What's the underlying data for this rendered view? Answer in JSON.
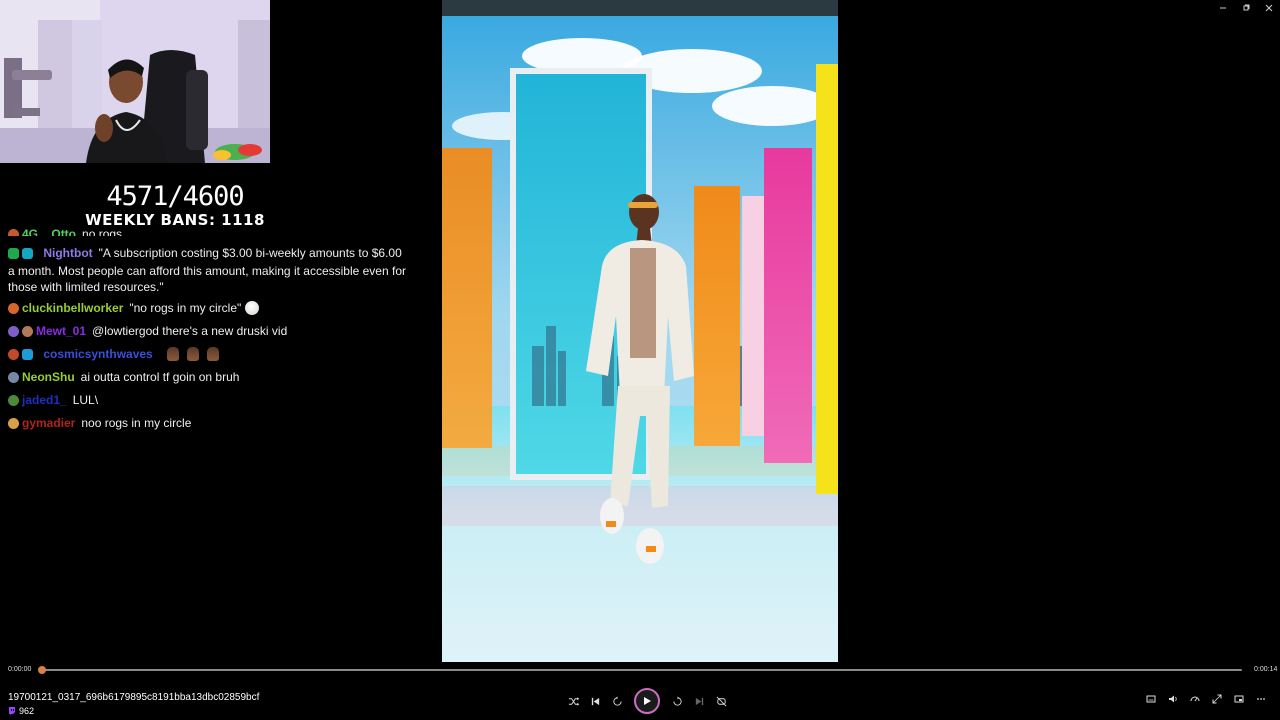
{
  "window": {
    "minimize_icon": "minimize-icon",
    "restore_icon": "restore-icon",
    "close_icon": "close-icon"
  },
  "overlay": {
    "counter": "4571/4600",
    "weekly_bans": "WEEKLY BANS: 1118"
  },
  "chat": {
    "clipped": {
      "user": "4G__Otto",
      "user_color": "#4fd35a",
      "message": "no rogs"
    },
    "messages": [
      {
        "user": "Nightbot",
        "user_color": "#8f7ae6",
        "message": "\"A subscription costing $3.00 bi-weekly amounts to $6.00 a month. Most people can afford this amount, making it accessible even for those with limited resources.\""
      },
      {
        "user": "cluckinbellworker",
        "user_color": "#9acd32",
        "message": "\"no rogs in my circle\""
      },
      {
        "user": "Mewt_01",
        "user_color": "#8a2be2",
        "message": "@lowtiergod there's a new druski vid"
      },
      {
        "user": "cosmicsynthwaves",
        "user_color": "#3a4fd8",
        "message": ""
      },
      {
        "user": "NeonShu",
        "user_color": "#9acd32",
        "message": "ai outta control tf goin on bruh"
      },
      {
        "user": "jaded1_",
        "user_color": "#1e2fbf",
        "message": "LUL\\"
      },
      {
        "user": "gymadier",
        "user_color": "#b22222",
        "message": "noo rogs in my circle"
      }
    ]
  },
  "player": {
    "time_current": "0:00:00",
    "time_total": "0:00:14",
    "progress": 0.0,
    "filename": "19700121_0317_696b6179895c8191bba13dbc02859bcf",
    "viewer_count": "962",
    "accent": "#c07a48"
  }
}
